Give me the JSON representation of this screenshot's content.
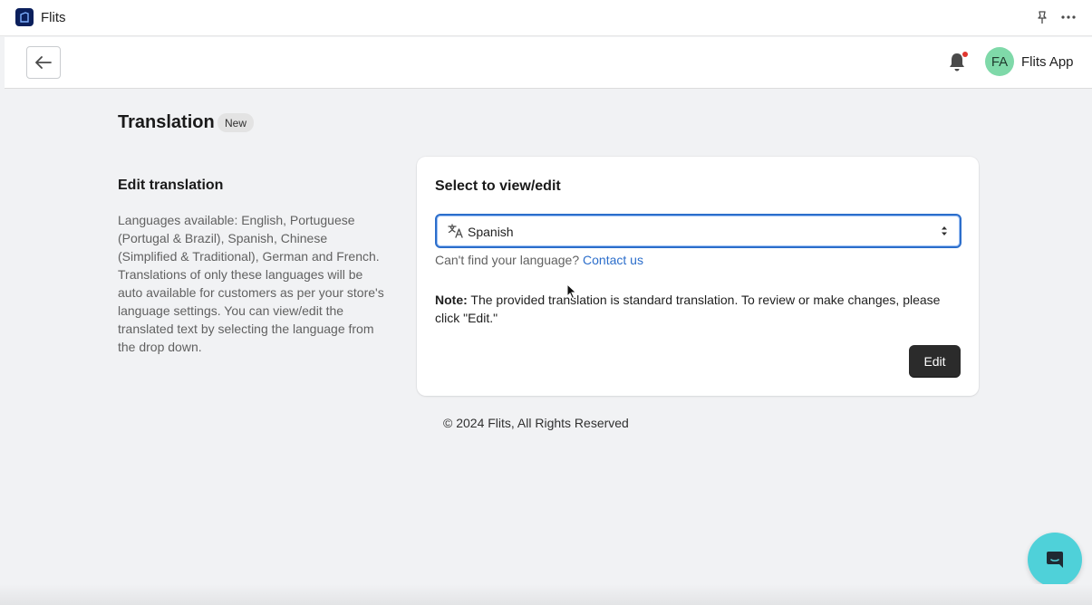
{
  "appbar": {
    "app_name": "Flits"
  },
  "header": {
    "user_initials": "FA",
    "user_name": "Flits App"
  },
  "page": {
    "title": "Translation",
    "badge": "New"
  },
  "section": {
    "title": "Edit translation",
    "description": "Languages available: English, Portuguese (Portugal & Brazil), Spanish, Chinese (Simplified & Traditional), German and French. Translations of only these languages will be auto available for customers as per your store's language settings. You can view/edit the translated text by selecting the language from the drop down."
  },
  "card": {
    "title": "Select to view/edit",
    "selected_language": "Spanish",
    "helper_text": "Can't find your language?",
    "contact_link": "Contact us",
    "note_label": "Note:",
    "note_text": " The provided translation is standard translation. To review or make changes, please click \"Edit.\"",
    "edit_label": "Edit"
  },
  "footer": {
    "text": "© 2024 Flits, All Rights Reserved"
  },
  "colors": {
    "accent": "#2c6ecb",
    "avatar": "#7fd9a9",
    "chat": "#4fd1d9",
    "notification_dot": "#e0362e"
  }
}
